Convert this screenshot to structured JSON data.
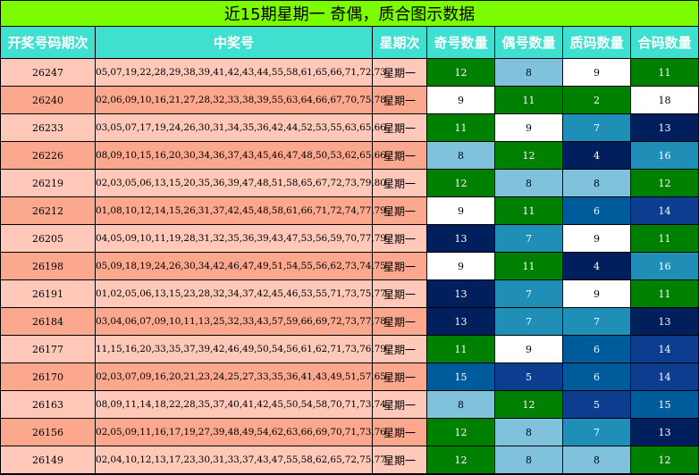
{
  "title": "近15期星期一 奇偶，质合图示数据",
  "headers": [
    "开奖号码期次",
    "中奖号",
    "星期次",
    "奇号数量",
    "偶号数量",
    "质码数量",
    "合码数量"
  ],
  "colors": {
    "1": "#ffffff",
    "2": "#008000",
    "4": "#001f5c",
    "5": "#0c3d8f",
    "6": "#005b9c",
    "7": "#1f8fb8",
    "8": "#80c2dc",
    "9": "#ffffff",
    "11": "#008000",
    "12": "#008000",
    "13": "#001f5c",
    "14": "#0c3d8f",
    "15": "#005b9c",
    "16": "#1f8fb8",
    "18": "#ffffff"
  },
  "rows": [
    {
      "issue": "26247",
      "numbers": "05,07,19,22,28,29,38,39,41,42,43,44,55,58,61,65,66,71,72,73",
      "weekday": "星期一",
      "odd": 12,
      "even": 8,
      "prime": 9,
      "composite": 11
    },
    {
      "issue": "26240",
      "numbers": "02,06,09,10,16,21,27,28,32,33,38,39,55,63,64,66,67,70,75,78",
      "weekday": "星期一",
      "odd": 9,
      "even": 11,
      "prime": 2,
      "composite": 18
    },
    {
      "issue": "26233",
      "numbers": "03,05,07,17,19,24,26,30,31,34,35,36,42,44,52,53,55,63,65,66",
      "weekday": "星期一",
      "odd": 11,
      "even": 9,
      "prime": 7,
      "composite": 13
    },
    {
      "issue": "26226",
      "numbers": "08,09,10,15,16,20,30,34,36,37,43,45,46,47,48,50,53,62,65,66",
      "weekday": "星期一",
      "odd": 8,
      "even": 12,
      "prime": 4,
      "composite": 16
    },
    {
      "issue": "26219",
      "numbers": "02,03,05,06,13,15,20,35,36,39,47,48,51,58,65,67,72,73,79,80",
      "weekday": "星期一",
      "odd": 12,
      "even": 8,
      "prime": 8,
      "composite": 12
    },
    {
      "issue": "26212",
      "numbers": "01,08,10,12,14,15,26,31,37,42,45,48,58,61,66,71,72,74,77,79",
      "weekday": "星期一",
      "odd": 9,
      "even": 11,
      "prime": 6,
      "composite": 14
    },
    {
      "issue": "26205",
      "numbers": "04,05,09,10,11,19,28,31,32,35,36,39,43,47,53,56,59,70,77,79",
      "weekday": "星期一",
      "odd": 13,
      "even": 7,
      "prime": 9,
      "composite": 11
    },
    {
      "issue": "26198",
      "numbers": "05,09,18,19,24,26,30,34,42,46,47,49,51,54,55,56,62,73,74,75",
      "weekday": "星期一",
      "odd": 9,
      "even": 11,
      "prime": 4,
      "composite": 16
    },
    {
      "issue": "26191",
      "numbers": "01,02,05,06,13,15,23,28,32,34,37,42,45,46,53,55,71,73,75,77",
      "weekday": "星期一",
      "odd": 13,
      "even": 7,
      "prime": 9,
      "composite": 11
    },
    {
      "issue": "26184",
      "numbers": "03,04,06,07,09,10,11,13,25,32,33,43,57,59,66,69,72,73,77,78",
      "weekday": "星期一",
      "odd": 13,
      "even": 7,
      "prime": 7,
      "composite": 13
    },
    {
      "issue": "26177",
      "numbers": "11,15,16,20,33,35,37,39,42,46,49,50,54,56,61,62,71,73,76,79",
      "weekday": "星期一",
      "odd": 11,
      "even": 9,
      "prime": 6,
      "composite": 14
    },
    {
      "issue": "26170",
      "numbers": "02,03,07,09,16,20,21,23,24,25,27,33,35,36,41,43,49,51,57,65",
      "weekday": "星期一",
      "odd": 15,
      "even": 5,
      "prime": 6,
      "composite": 14
    },
    {
      "issue": "26163",
      "numbers": "08,09,11,14,18,22,28,35,37,40,41,42,45,50,54,58,70,71,73,74",
      "weekday": "星期一",
      "odd": 8,
      "even": 12,
      "prime": 5,
      "composite": 15
    },
    {
      "issue": "26156",
      "numbers": "02,05,09,11,16,17,19,27,39,48,49,54,62,63,66,69,70,71,73,76",
      "weekday": "星期一",
      "odd": 12,
      "even": 8,
      "prime": 7,
      "composite": 13
    },
    {
      "issue": "26149",
      "numbers": "02,04,10,12,13,17,23,30,31,33,37,43,47,55,58,62,65,72,75,77",
      "weekday": "星期一",
      "odd": 12,
      "even": 8,
      "prime": 8,
      "composite": 12
    }
  ]
}
